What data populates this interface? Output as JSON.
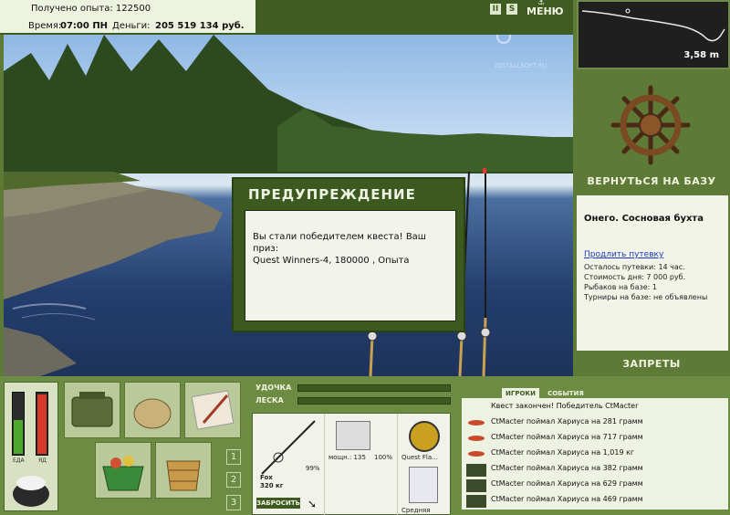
{
  "hud": {
    "experience": "Получено опыта: 122500",
    "time_label": "Время:",
    "time_value": "07:00 ПН",
    "money_label": "Деньги:",
    "money_value": "205 519 134 руб.",
    "pause_label": "II",
    "sound_label": "S",
    "menu_label": "МЕНЮ"
  },
  "watermark": {
    "text": "INSTALLSOFT.RU"
  },
  "depth": {
    "value": "3,58 m"
  },
  "location": {
    "return_label": "ВЕРНУТЬСЯ НА БАЗУ",
    "title": "Онего. Сосновая бухта",
    "extend_link": "Продлить путевку",
    "lines": [
      "Осталось путевки: 14 час.",
      "Стоимость дня: 7 000 руб.",
      "Рыбаков на базе: 1",
      "Турниры на базе: не объявлены"
    ],
    "bans_label": "ЗАПРЕТЫ"
  },
  "meters": {
    "food_label": "ЕДА",
    "poison_label": "ЯД",
    "food_level": 0.55,
    "poison_level": 0.95
  },
  "slots": [
    "1",
    "2",
    "3"
  ],
  "rod_controls": {
    "rod_label": "УДОЧКА",
    "line_label": "ЛЕСКА"
  },
  "rod_card": {
    "rod_name": "Fox",
    "rod_weight": "320 кг",
    "rod_pct": "99%",
    "reel_power": "мощн.: 135",
    "reel_pct": "100%",
    "line_name": "Quest Fla...",
    "lure_name": "Средняя",
    "launch_label": "ЗАБРОСИТЬ"
  },
  "events": {
    "tab_players": "ИГРОКИ",
    "tab_events": "СОБЫТИЯ",
    "items": [
      "Квест закончен! Победитель CtMacter",
      "CtMacter поймал Хариуса на 281 грамм",
      "CtMacter поймал Хариуса на 717 грамм",
      "CtMacter поймал Хариуса на 1,019 кг",
      "CtMacter поймал Хариуса на 382 грамм",
      "CtMacter поймал Хариуса на 629 грамм",
      "CtMacter поймал Хариуса на 469 грамм"
    ]
  },
  "dialog": {
    "title": "ПРЕДУПРЕЖДЕНИЕ",
    "line1": "Вы стали победителем квеста! Ваш приз:",
    "line2": "Quest Winners-4, 180000 , Опыта"
  },
  "colors": {
    "panel": "#5d7a36",
    "dark": "#3c5a1f",
    "light": "#f2f4ec",
    "link": "#1a3ac0"
  }
}
